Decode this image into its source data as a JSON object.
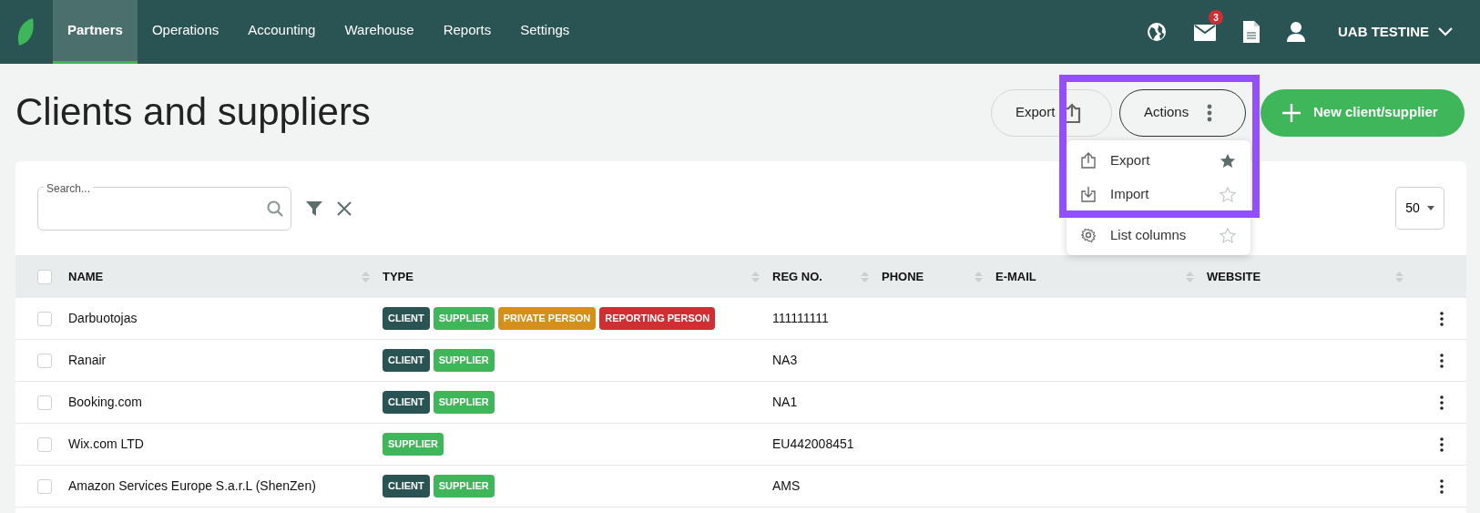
{
  "topbar": {
    "menu": [
      {
        "label": "Partners",
        "selected": true
      },
      {
        "label": "Operations",
        "selected": false
      },
      {
        "label": "Accounting",
        "selected": false
      },
      {
        "label": "Warehouse",
        "selected": false
      },
      {
        "label": "Reports",
        "selected": false
      },
      {
        "label": "Settings",
        "selected": false
      }
    ],
    "mail_count": "3",
    "company": "UAB TESTINE"
  },
  "page": {
    "title": "Clients and suppliers",
    "export_button": "Export",
    "actions_button": "Actions",
    "new_button": "New client/supplier"
  },
  "actions_menu": [
    {
      "kind": "export",
      "label": "Export",
      "favorite": true
    },
    {
      "kind": "import",
      "label": "Import",
      "favorite": false
    },
    {
      "kind": "columns",
      "label": "List columns",
      "favorite": false
    }
  ],
  "search": {
    "placeholder": "Search..."
  },
  "page_size": "50",
  "select_all": {
    "checked": false
  },
  "table": {
    "columns": [
      "NAME",
      "TYPE",
      "REG NO.",
      "PHONE",
      "E-MAIL",
      "WEBSITE"
    ],
    "rows": [
      {
        "checked": false,
        "name": "Darbuotojas",
        "tags": [
          {
            "label": "CLIENT",
            "color": "#2a5453"
          },
          {
            "label": "SUPPLIER",
            "color": "#3fb65a"
          },
          {
            "label": "PRIVATE PERSON",
            "color": "#d4901a"
          },
          {
            "label": "REPORTING PERSON",
            "color": "#cf2e33"
          }
        ],
        "reg_no": "111111111"
      },
      {
        "checked": false,
        "name": "Ranair",
        "tags": [
          {
            "label": "CLIENT",
            "color": "#2a5453"
          },
          {
            "label": "SUPPLIER",
            "color": "#3fb65a"
          }
        ],
        "reg_no": "NA3"
      },
      {
        "checked": false,
        "name": "Booking.com",
        "tags": [
          {
            "label": "CLIENT",
            "color": "#2a5453"
          },
          {
            "label": "SUPPLIER",
            "color": "#3fb65a"
          }
        ],
        "reg_no": "NA1"
      },
      {
        "checked": false,
        "name": "Wix.com LTD",
        "tags": [
          {
            "label": "SUPPLIER",
            "color": "#3fb65a"
          }
        ],
        "reg_no": "EU442008451"
      },
      {
        "checked": false,
        "name": "Amazon Services Europe S.a.r.L (ShenZen)",
        "tags": [
          {
            "label": "CLIENT",
            "color": "#2a5453"
          },
          {
            "label": "SUPPLIER",
            "color": "#3fb65a"
          }
        ],
        "reg_no": "AMS"
      }
    ]
  }
}
